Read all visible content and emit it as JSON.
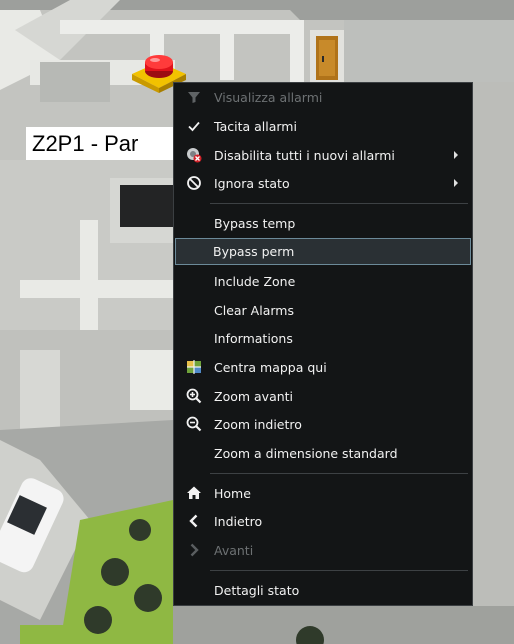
{
  "map": {
    "zone_label": "Z2P1 - Par"
  },
  "context_menu": {
    "items": [
      {
        "label": "Visualizza allarmi",
        "icon": "filter-icon",
        "disabled": true
      },
      {
        "label": "Tacita allarmi",
        "icon": "checkmark-icon",
        "checked": true
      },
      {
        "label": "Disabilita tutti i nuovi allarmi",
        "icon": "disable-alarm-icon",
        "submenu": true
      },
      {
        "label": "Ignora stato",
        "icon": "ban-icon",
        "submenu": true
      },
      {
        "label": "Bypass temp"
      },
      {
        "label": "Bypass perm",
        "highlighted": true
      },
      {
        "label": "Include Zone"
      },
      {
        "label": "Clear Alarms"
      },
      {
        "label": "Informations"
      },
      {
        "label": "Centra mappa qui",
        "icon": "center-map-icon"
      },
      {
        "label": "Zoom avanti",
        "icon": "zoom-in-icon"
      },
      {
        "label": "Zoom indietro",
        "icon": "zoom-out-icon"
      },
      {
        "label": "Zoom a dimensione standard"
      },
      {
        "label": "Home",
        "icon": "home-icon"
      },
      {
        "label": "Indietro",
        "icon": "back-icon"
      },
      {
        "label": "Avanti",
        "icon": "forward-icon",
        "disabled": true
      },
      {
        "label": "Dettagli stato"
      }
    ]
  },
  "colors": {
    "menu_background": "#131516",
    "menu_text": "#f2f2f2",
    "menu_disabled_text": "#6d7173",
    "highlight_border": "#6c8a99",
    "alarm_red": "#e0121b",
    "alarm_yellow": "#f2c200"
  }
}
